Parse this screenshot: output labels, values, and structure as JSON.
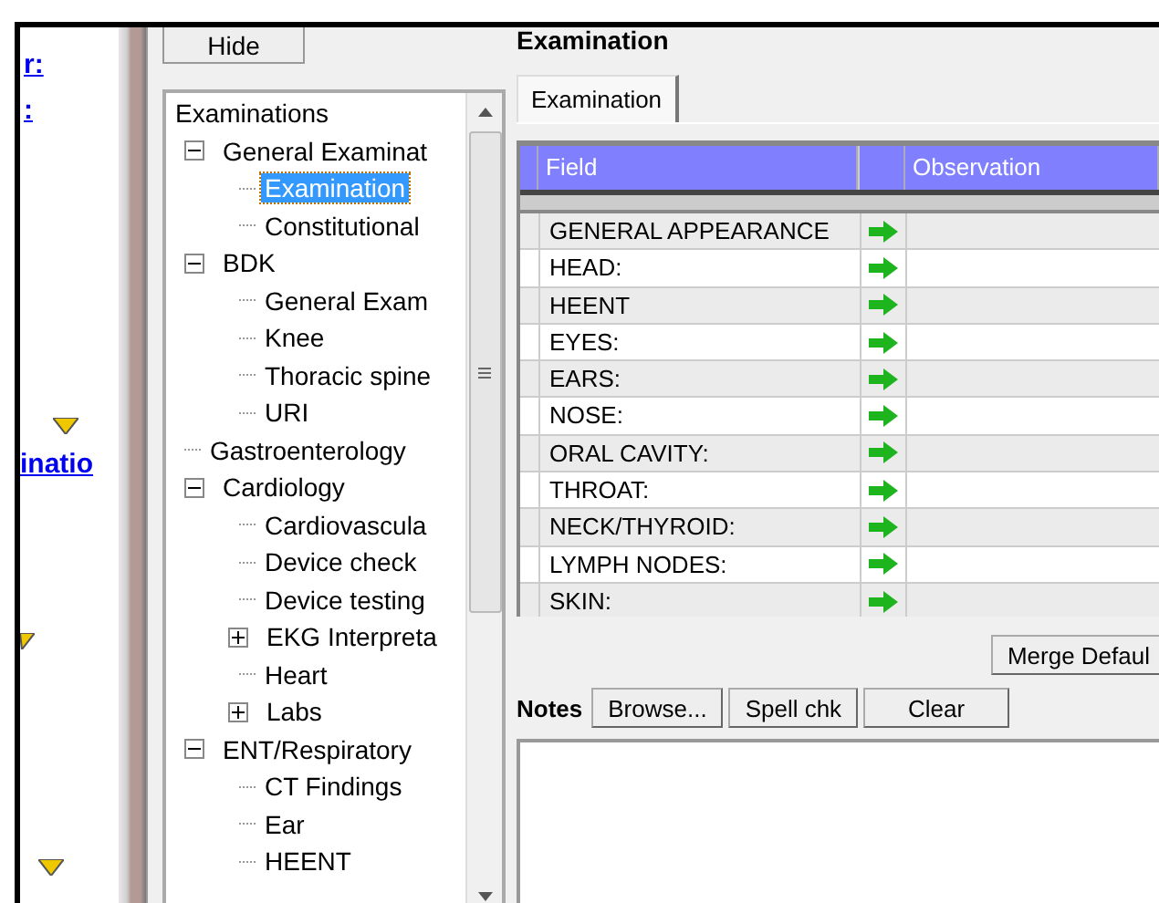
{
  "left_strip": {
    "links": [
      "r:",
      ":",
      "inatio"
    ]
  },
  "side_panel": {
    "hide_button": "Hide",
    "tree": [
      {
        "label": "Examinations",
        "selected": false,
        "children": [
          {
            "label": "General Examinat",
            "expanded": true,
            "selected": false,
            "children": [
              {
                "label": "Examination",
                "selected": true
              },
              {
                "label": "Constitutional",
                "selected": false
              }
            ]
          },
          {
            "label": "BDK",
            "expanded": true,
            "selected": false,
            "children": [
              {
                "label": "General Exam",
                "selected": false
              },
              {
                "label": "Knee",
                "selected": false
              },
              {
                "label": "Thoracic spine",
                "selected": false
              },
              {
                "label": "URI",
                "selected": false
              }
            ]
          },
          {
            "label": "Gastroenterology",
            "selected": false
          },
          {
            "label": "Cardiology",
            "expanded": true,
            "selected": false,
            "children": [
              {
                "label": "Cardiovascula",
                "selected": false
              },
              {
                "label": "Device check",
                "selected": false
              },
              {
                "label": "Device testing",
                "selected": false
              },
              {
                "label": "EKG Interpreta",
                "expanded": false,
                "selected": false
              },
              {
                "label": "Heart",
                "selected": false
              },
              {
                "label": "Labs",
                "expanded": false,
                "selected": false
              }
            ]
          },
          {
            "label": "ENT/Respiratory",
            "expanded": true,
            "selected": false,
            "children": [
              {
                "label": "CT Findings",
                "selected": false
              },
              {
                "label": "Ear",
                "selected": false
              },
              {
                "label": "HEENT",
                "selected": false
              }
            ]
          }
        ]
      }
    ]
  },
  "main": {
    "title": "Examination",
    "tabs": [
      {
        "label": "Examination",
        "selected": true
      }
    ],
    "table": {
      "columns": [
        "Field",
        "Observation"
      ],
      "rows": [
        {
          "field": "GENERAL APPEARANCE"
        },
        {
          "field": "HEAD:"
        },
        {
          "field": "HEENT"
        },
        {
          "field": "EYES:"
        },
        {
          "field": "EARS:"
        },
        {
          "field": "NOSE:"
        },
        {
          "field": "ORAL CAVITY:"
        },
        {
          "field": "THROAT:"
        },
        {
          "field": "NECK/THYROID:"
        },
        {
          "field": "LYMPH NODES:"
        },
        {
          "field": "SKIN:"
        }
      ]
    },
    "merge_button": "Merge Defaul",
    "notes": {
      "label": "Notes",
      "buttons": [
        "Browse...",
        "Spell chk",
        "Clear"
      ]
    }
  }
}
